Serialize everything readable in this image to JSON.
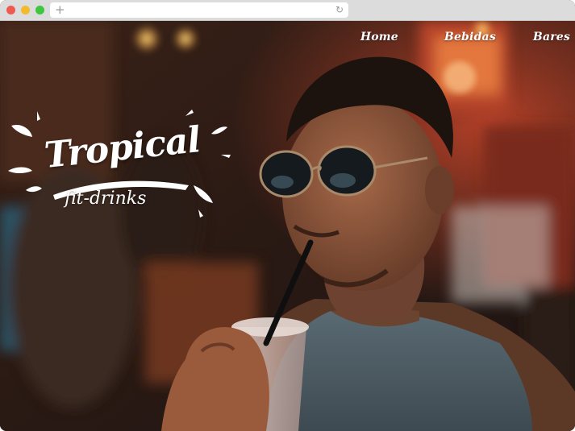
{
  "browser": {
    "new_tab_icon": "plus-icon",
    "reload_icon": "reload-icon",
    "traffic_lights": [
      "#ee5a52",
      "#f2bb2e",
      "#3ec63f"
    ]
  },
  "nav": {
    "items": [
      {
        "label": "Home"
      },
      {
        "label": "Bebidas"
      },
      {
        "label": "Bares"
      }
    ]
  },
  "logo": {
    "title": "Tropical",
    "subtitle": "fit-drinks"
  },
  "colors": {
    "text": "#ffffff",
    "background_warm": "#7a2a1c"
  }
}
